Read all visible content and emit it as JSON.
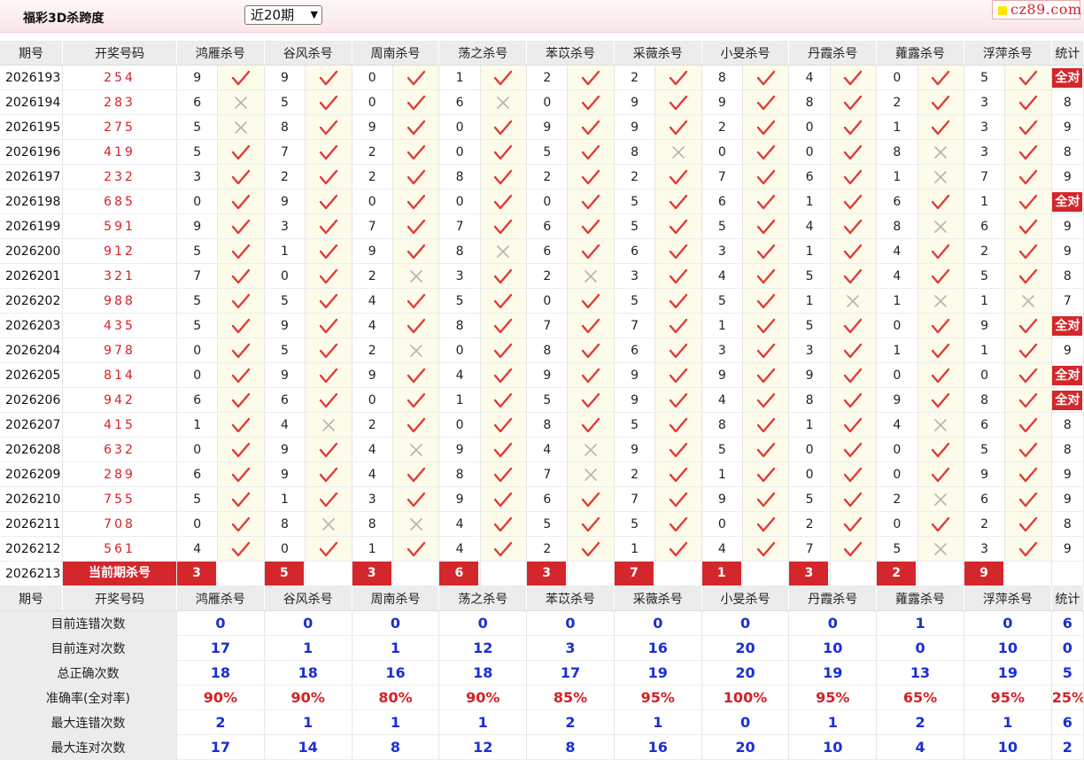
{
  "header": {
    "title": "福彩3D杀跨度",
    "select_value": "近20期",
    "logo": "cz89.com"
  },
  "columns": {
    "period": "期号",
    "draw": "开奖号码",
    "experts": [
      "鸿雁杀号",
      "谷风杀号",
      "周南杀号",
      "荡之杀号",
      "苯苡杀号",
      "采薇杀号",
      "小旻杀号",
      "丹霞杀号",
      "蕹露杀号",
      "浮萍杀号"
    ],
    "stat": "统计"
  },
  "rows": [
    {
      "period": "2026193",
      "draw": "254",
      "picks": [
        9,
        9,
        0,
        1,
        2,
        2,
        8,
        4,
        0,
        5
      ],
      "ok": [
        1,
        1,
        1,
        1,
        1,
        1,
        1,
        1,
        1,
        1
      ],
      "stat": "全对"
    },
    {
      "period": "2026194",
      "draw": "283",
      "picks": [
        6,
        5,
        0,
        6,
        0,
        9,
        9,
        8,
        2,
        3
      ],
      "ok": [
        0,
        1,
        1,
        0,
        1,
        1,
        1,
        1,
        1,
        1
      ],
      "stat": "8"
    },
    {
      "period": "2026195",
      "draw": "275",
      "picks": [
        5,
        8,
        9,
        0,
        9,
        9,
        2,
        0,
        1,
        3
      ],
      "ok": [
        0,
        1,
        1,
        1,
        1,
        1,
        1,
        1,
        1,
        1
      ],
      "stat": "9"
    },
    {
      "period": "2026196",
      "draw": "419",
      "picks": [
        5,
        7,
        2,
        0,
        5,
        8,
        0,
        0,
        8,
        3
      ],
      "ok": [
        1,
        1,
        1,
        1,
        1,
        0,
        1,
        1,
        0,
        1
      ],
      "stat": "8"
    },
    {
      "period": "2026197",
      "draw": "232",
      "picks": [
        3,
        2,
        2,
        8,
        2,
        2,
        7,
        6,
        1,
        7
      ],
      "ok": [
        1,
        1,
        1,
        1,
        1,
        1,
        1,
        1,
        0,
        1
      ],
      "stat": "9"
    },
    {
      "period": "2026198",
      "draw": "685",
      "picks": [
        0,
        9,
        0,
        0,
        0,
        5,
        6,
        1,
        6,
        1
      ],
      "ok": [
        1,
        1,
        1,
        1,
        1,
        1,
        1,
        1,
        1,
        1
      ],
      "stat": "全对"
    },
    {
      "period": "2026199",
      "draw": "591",
      "picks": [
        9,
        3,
        7,
        7,
        6,
        5,
        5,
        4,
        8,
        6
      ],
      "ok": [
        1,
        1,
        1,
        1,
        1,
        1,
        1,
        1,
        0,
        1
      ],
      "stat": "9"
    },
    {
      "period": "2026200",
      "draw": "912",
      "picks": [
        5,
        1,
        9,
        8,
        6,
        6,
        3,
        1,
        4,
        2
      ],
      "ok": [
        1,
        1,
        1,
        0,
        1,
        1,
        1,
        1,
        1,
        1
      ],
      "stat": "9"
    },
    {
      "period": "2026201",
      "draw": "321",
      "picks": [
        7,
        0,
        2,
        3,
        2,
        3,
        4,
        5,
        4,
        5
      ],
      "ok": [
        1,
        1,
        0,
        1,
        0,
        1,
        1,
        1,
        1,
        1
      ],
      "stat": "8"
    },
    {
      "period": "2026202",
      "draw": "988",
      "picks": [
        5,
        5,
        4,
        5,
        0,
        5,
        5,
        1,
        1,
        1
      ],
      "ok": [
        1,
        1,
        1,
        1,
        1,
        1,
        1,
        0,
        0,
        0
      ],
      "stat": "7"
    },
    {
      "period": "2026203",
      "draw": "435",
      "picks": [
        5,
        9,
        4,
        8,
        7,
        7,
        1,
        5,
        0,
        9
      ],
      "ok": [
        1,
        1,
        1,
        1,
        1,
        1,
        1,
        1,
        1,
        1
      ],
      "stat": "全对"
    },
    {
      "period": "2026204",
      "draw": "978",
      "picks": [
        0,
        5,
        2,
        0,
        8,
        6,
        3,
        3,
        1,
        1
      ],
      "ok": [
        1,
        1,
        0,
        1,
        1,
        1,
        1,
        1,
        1,
        1
      ],
      "stat": "9"
    },
    {
      "period": "2026205",
      "draw": "814",
      "picks": [
        0,
        9,
        9,
        4,
        9,
        9,
        9,
        9,
        0,
        0
      ],
      "ok": [
        1,
        1,
        1,
        1,
        1,
        1,
        1,
        1,
        1,
        1
      ],
      "stat": "全对"
    },
    {
      "period": "2026206",
      "draw": "942",
      "picks": [
        6,
        6,
        0,
        1,
        5,
        9,
        4,
        8,
        9,
        8
      ],
      "ok": [
        1,
        1,
        1,
        1,
        1,
        1,
        1,
        1,
        1,
        1
      ],
      "stat": "全对"
    },
    {
      "period": "2026207",
      "draw": "415",
      "picks": [
        1,
        4,
        2,
        0,
        8,
        5,
        8,
        1,
        4,
        6
      ],
      "ok": [
        1,
        0,
        1,
        1,
        1,
        1,
        1,
        1,
        0,
        1
      ],
      "stat": "8"
    },
    {
      "period": "2026208",
      "draw": "632",
      "picks": [
        0,
        9,
        4,
        9,
        4,
        9,
        5,
        0,
        0,
        5
      ],
      "ok": [
        1,
        1,
        0,
        1,
        0,
        1,
        1,
        1,
        1,
        1
      ],
      "stat": "8"
    },
    {
      "period": "2026209",
      "draw": "289",
      "picks": [
        6,
        9,
        4,
        8,
        7,
        2,
        1,
        0,
        0,
        9
      ],
      "ok": [
        1,
        1,
        1,
        1,
        0,
        1,
        1,
        1,
        1,
        1
      ],
      "stat": "9"
    },
    {
      "period": "2026210",
      "draw": "755",
      "picks": [
        5,
        1,
        3,
        9,
        6,
        7,
        9,
        5,
        2,
        6
      ],
      "ok": [
        1,
        1,
        1,
        1,
        1,
        1,
        1,
        1,
        0,
        1
      ],
      "stat": "9"
    },
    {
      "period": "2026211",
      "draw": "708",
      "picks": [
        0,
        8,
        8,
        4,
        5,
        5,
        0,
        2,
        0,
        2
      ],
      "ok": [
        1,
        0,
        0,
        1,
        1,
        1,
        1,
        1,
        1,
        1
      ],
      "stat": "8"
    },
    {
      "period": "2026212",
      "draw": "561",
      "picks": [
        4,
        0,
        1,
        4,
        2,
        1,
        4,
        7,
        5,
        3
      ],
      "ok": [
        1,
        1,
        1,
        1,
        1,
        1,
        1,
        1,
        0,
        1
      ],
      "stat": "9"
    }
  ],
  "current": {
    "period": "2026213",
    "label": "当前期杀号",
    "picks": [
      "3",
      "5",
      "3",
      "6",
      "3",
      "7",
      "1",
      "3",
      "2",
      "9"
    ]
  },
  "summary": [
    {
      "label": "目前连错次数",
      "values": [
        "0",
        "0",
        "0",
        "0",
        "0",
        "0",
        "0",
        "0",
        "1",
        "0"
      ],
      "stat": "6",
      "red": false
    },
    {
      "label": "目前连对次数",
      "values": [
        "17",
        "1",
        "1",
        "12",
        "3",
        "16",
        "20",
        "10",
        "0",
        "10"
      ],
      "stat": "0",
      "red": false
    },
    {
      "label": "总正确次数",
      "values": [
        "18",
        "18",
        "16",
        "18",
        "17",
        "19",
        "20",
        "19",
        "13",
        "19"
      ],
      "stat": "5",
      "red": false
    },
    {
      "label": "准确率(全对率)",
      "values": [
        "90%",
        "90%",
        "80%",
        "90%",
        "85%",
        "95%",
        "100%",
        "95%",
        "65%",
        "95%"
      ],
      "stat": "25%",
      "red": true
    },
    {
      "label": "最大连错次数",
      "values": [
        "2",
        "1",
        "1",
        "1",
        "2",
        "1",
        "0",
        "1",
        "2",
        "1"
      ],
      "stat": "6",
      "red": false
    },
    {
      "label": "最大连对次数",
      "values": [
        "17",
        "14",
        "8",
        "12",
        "8",
        "16",
        "20",
        "10",
        "4",
        "10"
      ],
      "stat": "2",
      "red": false
    }
  ],
  "icons": {
    "ok": "check-icon",
    "wrong": "cross-icon",
    "ok_color": "#e03a3a",
    "wrong_color": "#b5b5b5"
  }
}
